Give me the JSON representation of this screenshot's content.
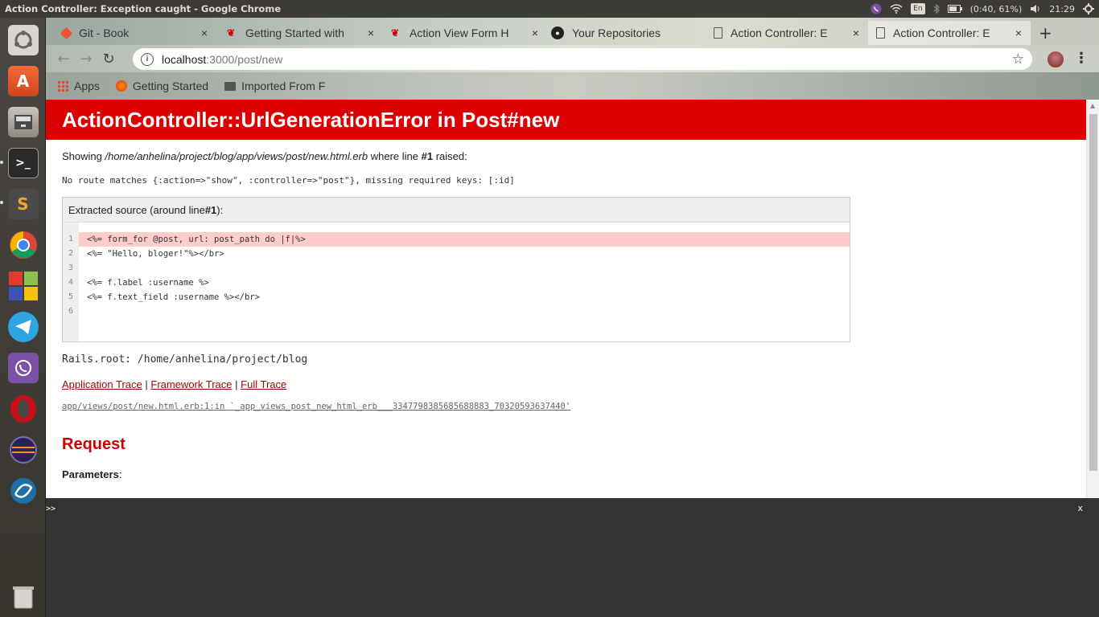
{
  "os": {
    "window_title": "Action Controller: Exception caught - Google Chrome",
    "battery": "(0:40, 61%)",
    "clock": "21:29",
    "keyboard": "En"
  },
  "launcher": {
    "items": [
      "ubuntu-dash",
      "software-center",
      "files",
      "terminal",
      "sublime-text",
      "chrome",
      "app-grid",
      "telegram",
      "viber",
      "opera",
      "eclipse",
      "app-s",
      "trash"
    ]
  },
  "tabs": [
    {
      "label": "Git - Book",
      "close": "×"
    },
    {
      "label": "Getting Started with",
      "close": "×"
    },
    {
      "label": "Action View Form H",
      "close": "×"
    },
    {
      "label": "Your Repositories",
      "close": ""
    },
    {
      "label": "Action Controller: E",
      "close": "×"
    },
    {
      "label": "Action Controller: E",
      "close": "×"
    }
  ],
  "toolbar": {
    "url_host": "localhost",
    "url_path": ":3000/post/new"
  },
  "bookmarks": [
    {
      "label": "Apps"
    },
    {
      "label": "Getting Started"
    },
    {
      "label": "Imported From F"
    }
  ],
  "page": {
    "header": "ActionController::UrlGenerationError in Post#new",
    "showing_prefix": "Showing ",
    "showing_path": "/home/anhelina/project/blog/app/views/post/new.html.erb",
    "showing_mid": " where line ",
    "showing_line": "#1",
    "showing_suffix": " raised:",
    "message": "No route matches {:action=>\"show\", :controller=>\"post\"}, missing required keys: [:id]",
    "source_head_prefix": "Extracted source (around line ",
    "source_head_line": "#1",
    "source_head_suffix": "):",
    "source_lines": [
      {
        "num": "1",
        "code": "<%= form_for @post, url: post_path do |f|%>"
      },
      {
        "num": "2",
        "code": "<%= \"Hello, bloger!\"%></br>"
      },
      {
        "num": "3",
        "code": ""
      },
      {
        "num": "4",
        "code": "<%= f.label :username %>"
      },
      {
        "num": "5",
        "code": "<%= f.text_field :username %></br>"
      },
      {
        "num": "6",
        "code": ""
      }
    ],
    "rails_root": "Rails.root: /home/anhelina/project/blog",
    "trace_links": [
      "Application Trace",
      "Framework Trace",
      "Full Trace"
    ],
    "trace_sep": "|",
    "trace_line": "app/views/post/new.html.erb:1:in `_app_views_post_new_html_erb___3347798385685688883_70320593637440'",
    "request_heading": "Request",
    "params_label": "Parameters",
    "params_colon": ":"
  },
  "console": {
    "prompt": ">>",
    "close": "x"
  },
  "colors": {
    "header_red": "#dd0000",
    "link": "#980905",
    "highlight": "#ffcccc"
  }
}
